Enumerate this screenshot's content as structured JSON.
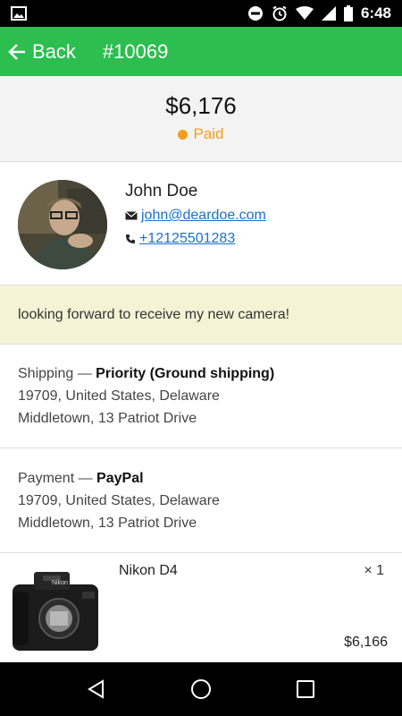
{
  "status_bar": {
    "time": "6:48",
    "icons": [
      "image-icon",
      "do-not-disturb-icon",
      "alarm-icon",
      "wifi-icon",
      "signal-icon",
      "battery-icon"
    ]
  },
  "app_bar": {
    "back_label": "Back",
    "order_id": "#10069",
    "color": "#2cbe4e"
  },
  "summary": {
    "total": "$6,176",
    "status": "Paid",
    "status_color": "#f59d1b"
  },
  "customer": {
    "name": "John Doe",
    "email": "john@deardoe.com",
    "phone": "+12125501283",
    "email_icon": "envelope-icon",
    "phone_icon": "phone-icon"
  },
  "note": {
    "text": "looking forward to receive my new camera!"
  },
  "shipping": {
    "label": "Shipping —",
    "method": "Priority (Ground shipping)",
    "line1": "19709, United States, Delaware",
    "line2": "Middletown, 13 Patriot Drive"
  },
  "payment": {
    "label": "Payment —",
    "method": "PayPal",
    "line1": "19709, United States, Delaware",
    "line2": "Middletown, 13 Patriot Drive"
  },
  "product": {
    "name": "Nikon D4",
    "quantity": "× 1",
    "price": "$6,166"
  },
  "nav_bar": {
    "buttons": [
      "back-triangle-icon",
      "home-circle-icon",
      "recents-square-icon"
    ]
  }
}
